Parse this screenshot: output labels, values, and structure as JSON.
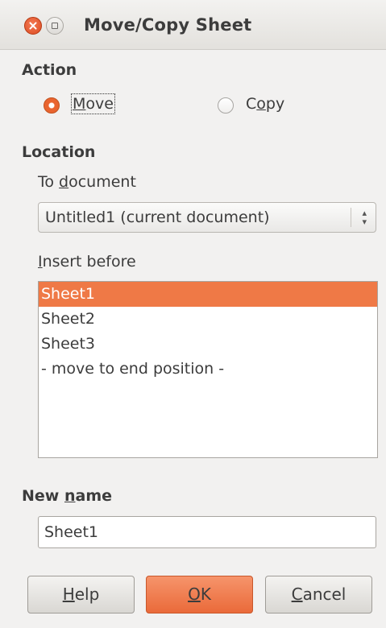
{
  "window": {
    "title": "Move/Copy Sheet",
    "close_icon": "close-icon",
    "maximize_icon": "maximize-icon"
  },
  "action": {
    "heading": "Action",
    "options": [
      {
        "prefix": "",
        "mnemonic": "M",
        "rest": "ove",
        "selected": true
      },
      {
        "prefix": "C",
        "mnemonic": "o",
        "rest": "py",
        "selected": false
      }
    ]
  },
  "location": {
    "heading": "Location",
    "to_document_prefix": "To ",
    "to_document_mnemonic": "d",
    "to_document_rest": "ocument",
    "document_selected": "Untitled1 (current document)",
    "insert_before_mnemonic": "I",
    "insert_before_rest": "nsert before",
    "sheets": [
      "Sheet1",
      "Sheet2",
      "Sheet3",
      "- move to end position -"
    ],
    "selected_index": 0
  },
  "new_name": {
    "label_prefix": "New ",
    "label_mnemonic": "n",
    "label_rest": "ame",
    "value": "Sheet1"
  },
  "buttons": {
    "help_mnemonic": "H",
    "help_rest": "elp",
    "ok_mnemonic": "O",
    "ok_rest": "K",
    "cancel_mnemonic": "C",
    "cancel_rest": "ancel"
  },
  "colors": {
    "accent": "#ef7946",
    "background": "#f2f1f0"
  }
}
